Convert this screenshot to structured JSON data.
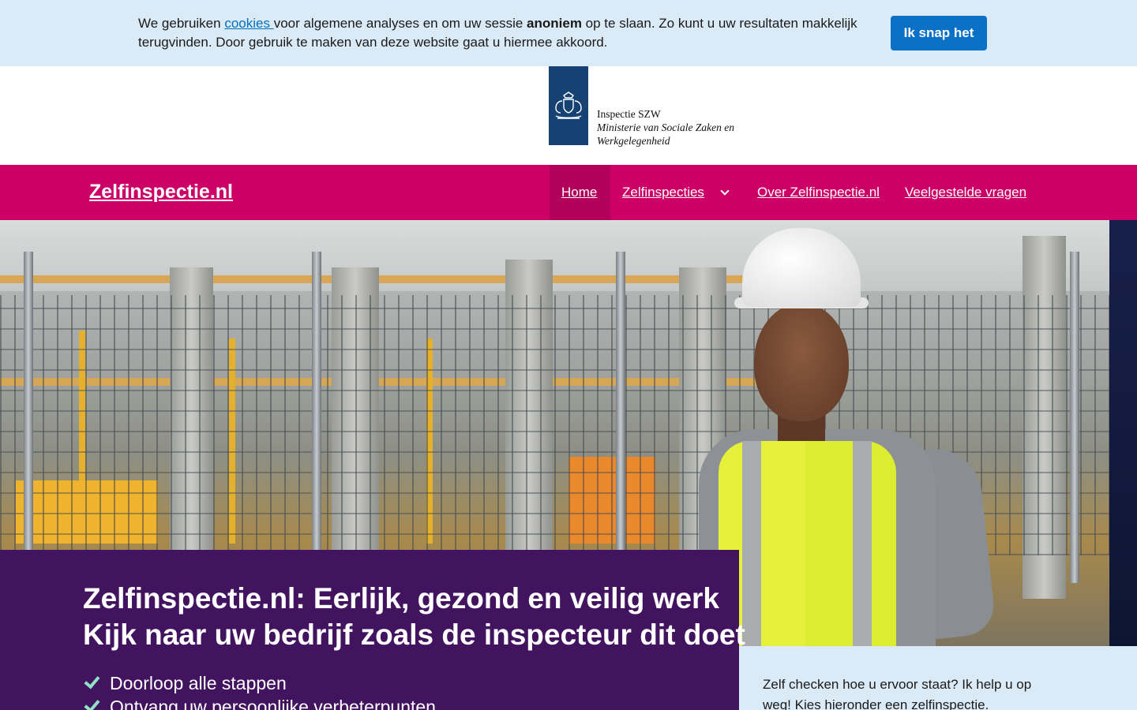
{
  "cookie_bar": {
    "text_before": "We gebruiken ",
    "link": "cookies ",
    "text_middle": "voor algemene analyses en om uw sessie ",
    "bold": "anoniem",
    "text_after": " op te slaan. Zo kunt u uw resultaten makkelijk terugvinden. Door gebruik te maken van deze website gaat u hiermee akkoord.",
    "button_label": "Ik snap het"
  },
  "logo": {
    "line1": "Inspectie SZW",
    "line2": "Ministerie van Sociale Zaken en",
    "line3": "Werkgelegenheid"
  },
  "nav": {
    "brand": "Zelfinspectie.nl",
    "items": [
      {
        "label": "Home",
        "active": true
      },
      {
        "label": "Zelfinspecties",
        "has_dropdown": true
      },
      {
        "label": "Over Zelfinspectie.nl"
      },
      {
        "label": "Veelgestelde vragen"
      }
    ]
  },
  "hero": {
    "headline": "Zelfinspectie.nl: Eerlijk, gezond en veilig werk",
    "subheadline": "Kijk naar uw bedrijf zoals de inspecteur dit doet",
    "checklist": [
      "Doorloop alle stappen",
      "Ontvang uw persoonlijke verbeterpunten"
    ]
  },
  "intro": {
    "text": "Zelf checken hoe u ervoor staat? Ik help u op weg! Kies hieronder een zelfinspectie."
  },
  "colors": {
    "nav_bg": "#cc0066",
    "panel_purple": "#42145f",
    "cookie_bg": "#daeaf6",
    "button_blue": "#0b71c7",
    "logo_blue": "#154273"
  }
}
